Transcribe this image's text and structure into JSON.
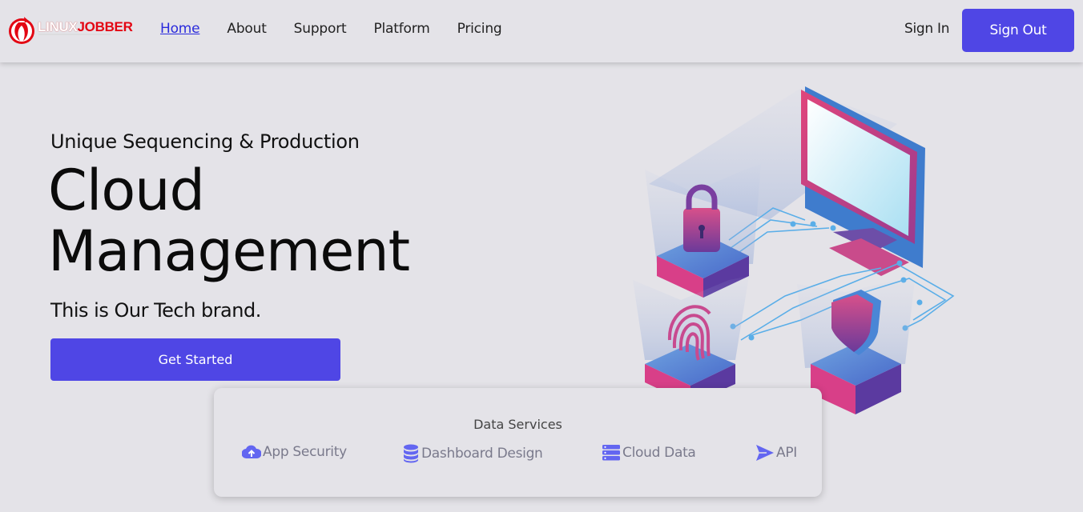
{
  "brand": {
    "logo_part1": "LINUX",
    "logo_part2": "JOBBER"
  },
  "nav": {
    "links": [
      "Home",
      "About",
      "Support",
      "Platform",
      "Pricing"
    ],
    "active": "Home",
    "signin": "Sign In",
    "signout": "Sign Out"
  },
  "hero": {
    "subtitle": "Unique Sequencing & Production",
    "title_line1": "Cloud",
    "title_line2": "Management",
    "tagline": "This is Our Tech brand.",
    "cta": "Get Started"
  },
  "services": {
    "title": "Data Services",
    "items": [
      {
        "label": "App Security",
        "icon": "cloud-upload-icon"
      },
      {
        "label": "Dashboard Design",
        "icon": "database-icon"
      },
      {
        "label": "Cloud Data",
        "icon": "server-icon"
      },
      {
        "label": "API",
        "icon": "paper-plane-icon"
      }
    ]
  },
  "colors": {
    "accent": "#4f46e5",
    "background": "#e4e3e8",
    "logo_red": "#e30613",
    "icon_color": "#6366f1"
  }
}
